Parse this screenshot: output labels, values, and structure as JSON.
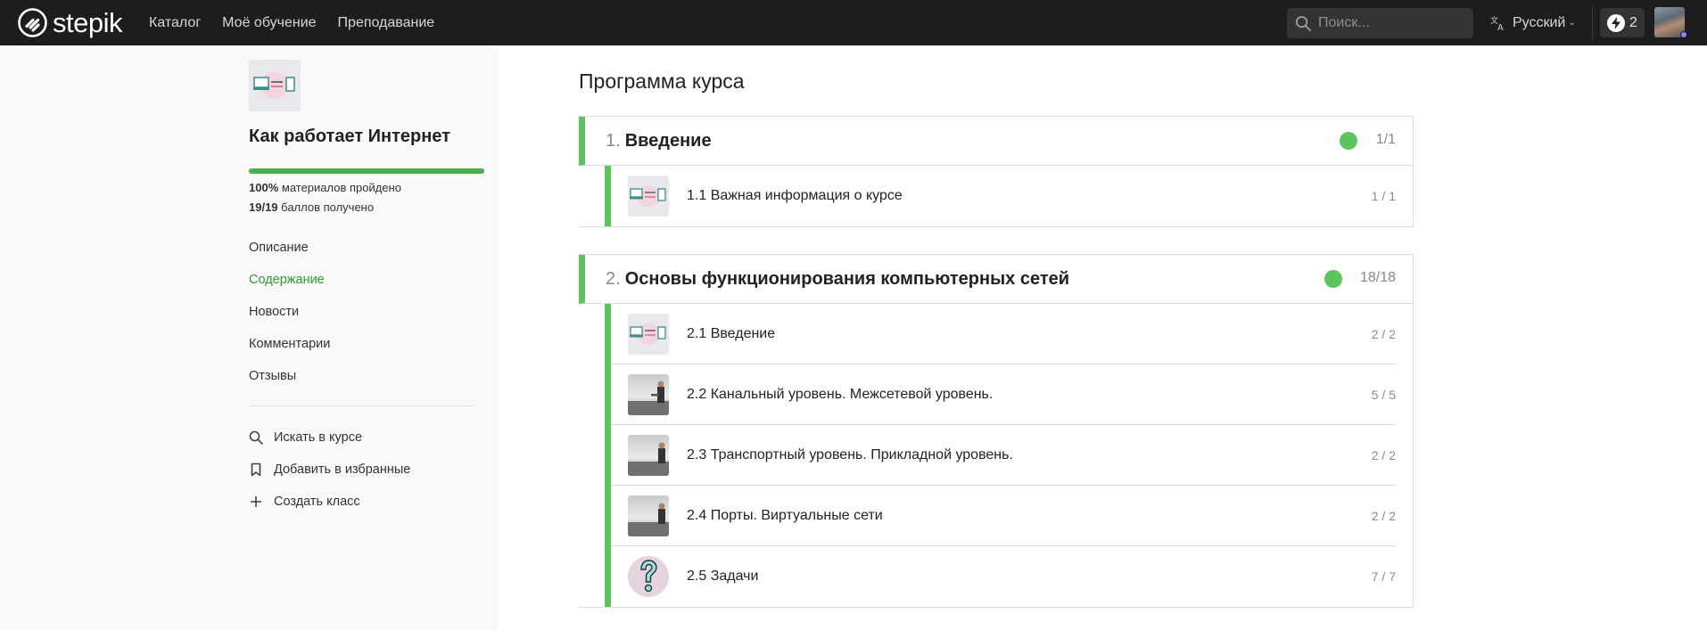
{
  "header": {
    "logo_text": "stepik",
    "nav": [
      "Каталог",
      "Моё обучение",
      "Преподавание"
    ],
    "search_placeholder": "Поиск...",
    "language": "Русский",
    "energy_count": "2"
  },
  "sidebar": {
    "course_title": "Как работает Интернет",
    "progress": {
      "fraction": 1.0,
      "materials_pct": "100%",
      "materials_text": "материалов пройдено",
      "points": "19/19",
      "points_text": "баллов получено"
    },
    "nav": [
      {
        "label": "Описание",
        "active": false
      },
      {
        "label": "Содержание",
        "active": true
      },
      {
        "label": "Новости",
        "active": false
      },
      {
        "label": "Комментарии",
        "active": false
      },
      {
        "label": "Отзывы",
        "active": false
      }
    ],
    "actions": [
      {
        "label": "Искать в курсе",
        "icon": "search-icon"
      },
      {
        "label": "Добавить в избранные",
        "icon": "bookmark-icon"
      },
      {
        "label": "Создать класс",
        "icon": "plus-icon"
      }
    ]
  },
  "main": {
    "title": "Программа курса",
    "sections": [
      {
        "num": "1.",
        "name": "Введение",
        "count": "1/1",
        "lessons": [
          {
            "title": "1.1 Важная информация о курсе",
            "count": "1 / 1",
            "thumb": "intro"
          }
        ]
      },
      {
        "num": "2.",
        "name": "Основы функционирования компьютерных сетей",
        "count": "18/18",
        "lessons": [
          {
            "title": "2.1 Введение",
            "count": "2 / 2",
            "thumb": "intro"
          },
          {
            "title": "2.2 Канальный уровень. Межсетевой уровень.",
            "count": "5 / 5",
            "thumb": "video"
          },
          {
            "title": "2.3 Транспортный уровень. Прикладной уровень.",
            "count": "2 / 2",
            "thumb": "video"
          },
          {
            "title": "2.4 Порты. Виртуальные сети",
            "count": "2 / 2",
            "thumb": "video"
          },
          {
            "title": "2.5 Задачи",
            "count": "7 / 7",
            "thumb": "question"
          }
        ]
      }
    ]
  },
  "colors": {
    "accent_green": "#5cc45c",
    "active_link": "#2e9a2e",
    "topbar": "#1d1d1f"
  }
}
